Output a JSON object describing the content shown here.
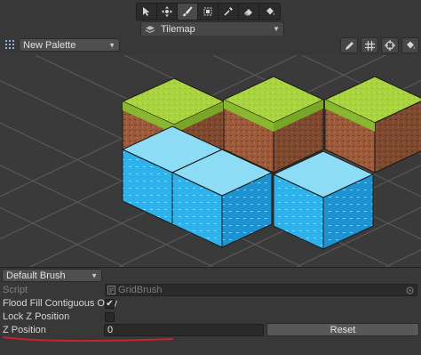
{
  "toolbar": {
    "tools": [
      {
        "name": "select-tool",
        "icon": "cursor-icon"
      },
      {
        "name": "move-tool",
        "icon": "move-icon"
      },
      {
        "name": "paint-tool",
        "icon": "brush-icon"
      },
      {
        "name": "box-fill-tool",
        "icon": "box-fill-icon"
      },
      {
        "name": "picker-tool",
        "icon": "eyedropper-icon"
      },
      {
        "name": "erase-tool",
        "icon": "eraser-icon"
      },
      {
        "name": "fill-tool",
        "icon": "bucket-icon"
      }
    ],
    "active_index": 2
  },
  "active_target": {
    "label": "Tilemap",
    "icon": "layers-icon"
  },
  "palette": {
    "label": "New Palette",
    "icon": "grid-dots-icon"
  },
  "palette_tools": [
    {
      "name": "edit-palette",
      "icon": "pencil-icon"
    },
    {
      "name": "grid-toggle",
      "icon": "grid-icon"
    },
    {
      "name": "gizmo-toggle",
      "icon": "crosshair-icon"
    },
    {
      "name": "palette-settings",
      "icon": "bucket-icon"
    }
  ],
  "brush": {
    "label": "Default Brush"
  },
  "inspector": {
    "script_label": "Script",
    "script_value": "GridBrush",
    "flood_fill_label": "Flood Fill Contiguous Only",
    "flood_fill_checked": true,
    "lock_z_label": "Lock Z Position",
    "lock_z_checked": false,
    "z_position_label": "Z Position",
    "z_position_value": "0",
    "reset_label": "Reset"
  },
  "colors": {
    "accent": "#c8242d",
    "grass": "#a9d440",
    "dirt": "#9c5a3a",
    "water": "#2fb2ea",
    "water_top": "#8ddcf5"
  }
}
